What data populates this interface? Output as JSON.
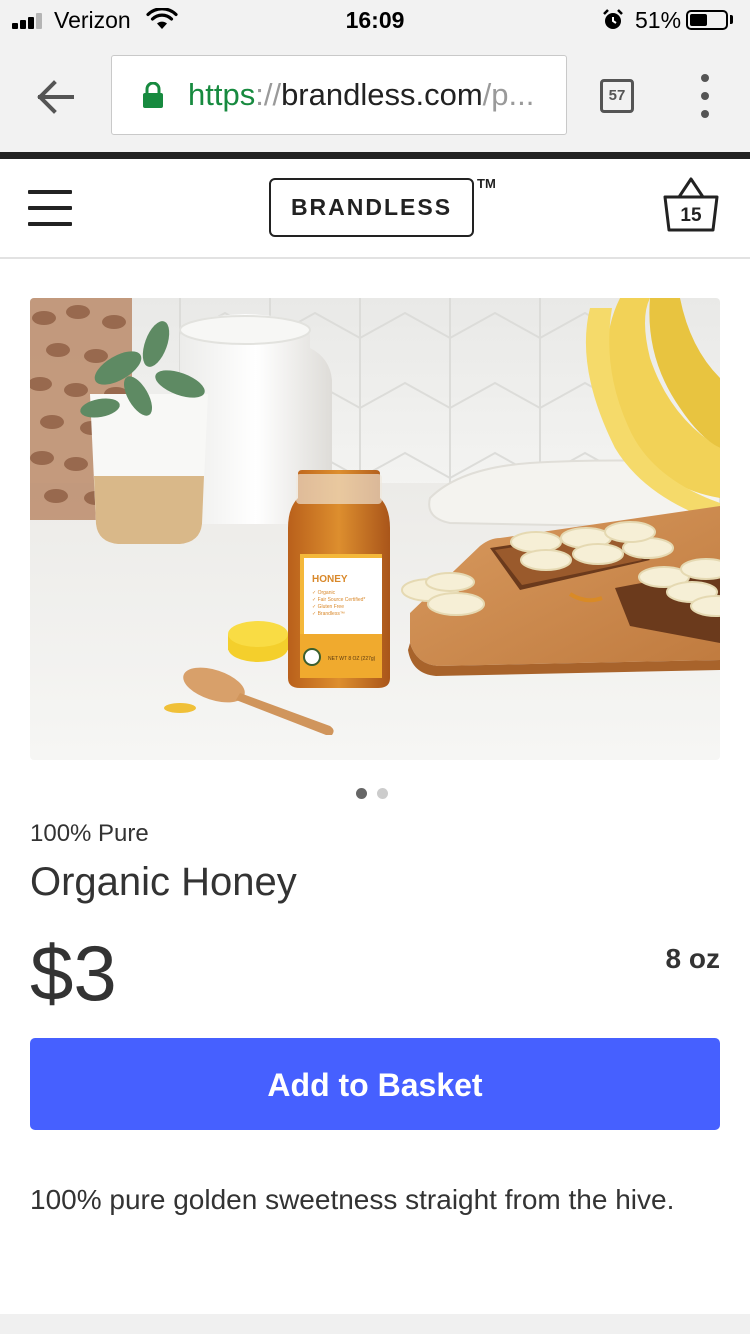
{
  "status_bar": {
    "carrier": "Verizon",
    "time": "16:09",
    "battery_percent": "51%",
    "battery_level": 0.51,
    "signal_bars": 3,
    "icons": [
      "signal-icon",
      "wifi-icon",
      "alarm-icon",
      "battery-icon"
    ]
  },
  "browser": {
    "url_scheme": "https",
    "url_separator": "://",
    "url_host": "brandless.com",
    "url_path": "/p...",
    "tab_count": "57",
    "icons": [
      "back-arrow-icon",
      "lock-icon",
      "tabs-icon",
      "more-vert-icon"
    ],
    "secure_color": "#178a3f"
  },
  "header": {
    "logo": "BRANDLESS",
    "trademark": "TM",
    "cart_count": "15",
    "icons": [
      "hamburger-menu-icon",
      "basket-icon"
    ]
  },
  "product": {
    "carousel_total": 2,
    "carousel_active": 1,
    "eyebrow": "100% Pure",
    "title": "Organic Honey",
    "price": "$3",
    "size": "8 oz",
    "add_button": "Add to Basket",
    "description": "100% pure golden sweetness straight from the hive.",
    "jar_label": "HONEY",
    "jar_label_lines": [
      "✓ Organic",
      "✓ Fair Source Certified*",
      "✓ Gluten Free",
      "✓ Brandless™"
    ],
    "jar_net_weight": "NET WT 8 OZ (227g)"
  },
  "colors": {
    "accent": "#4660ff",
    "text": "#333333",
    "chrome_bg": "#f2f2f2"
  }
}
